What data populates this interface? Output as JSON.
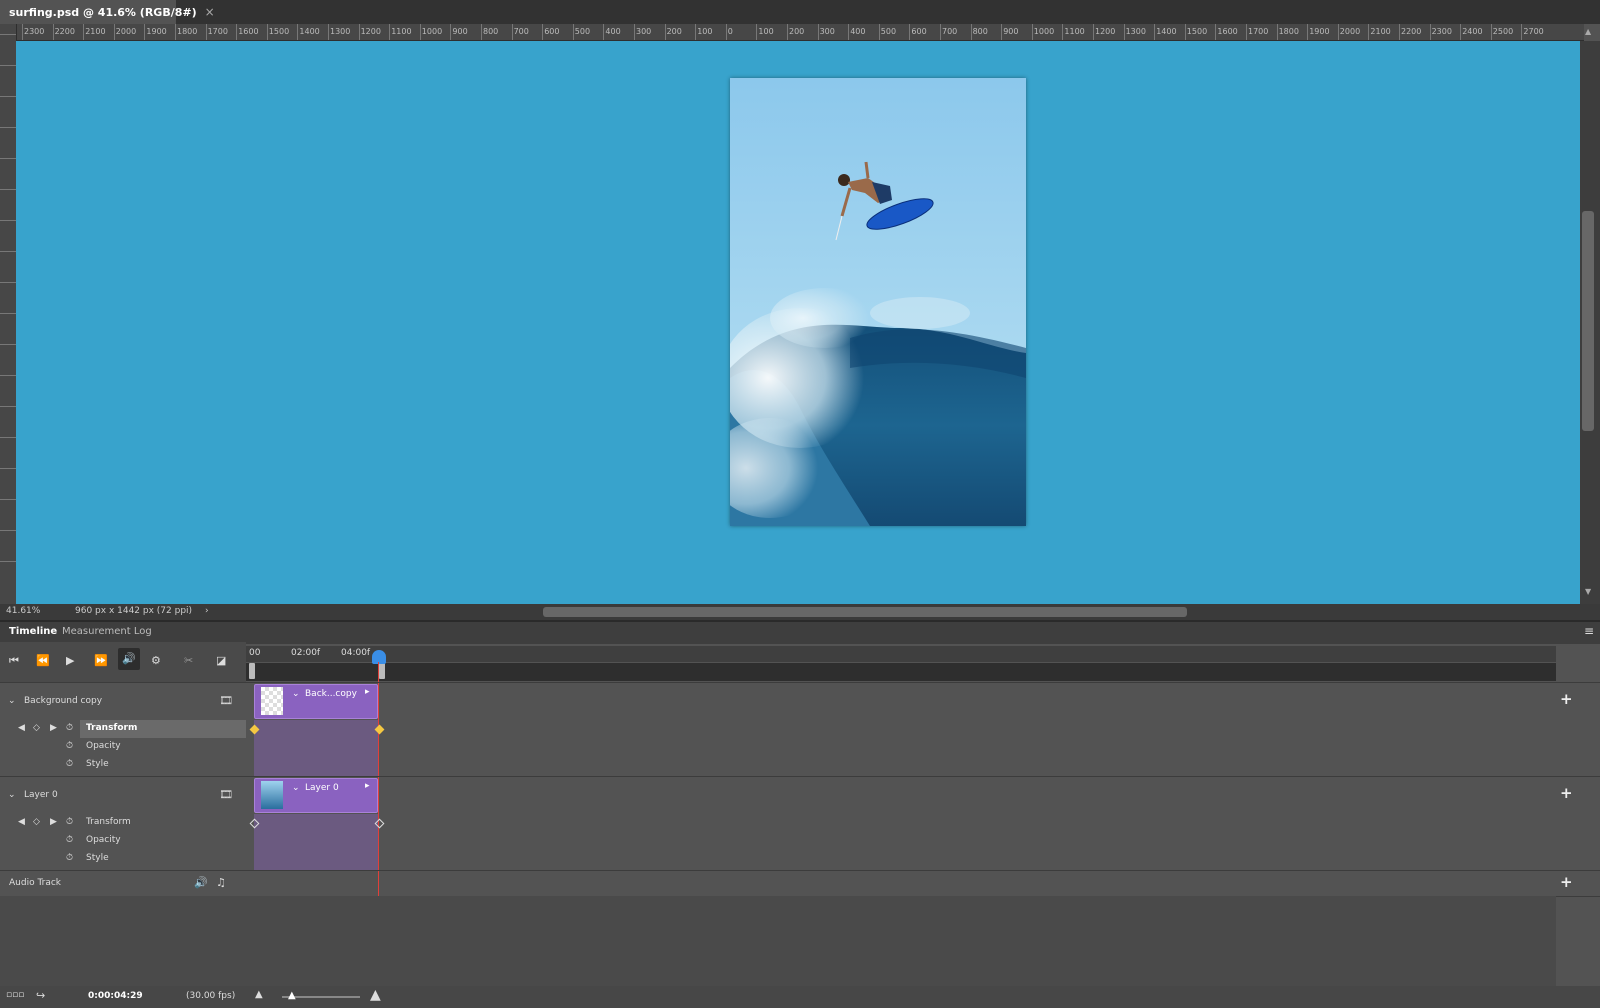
{
  "document": {
    "tab_title": "surfing.psd @ 41.6% (RGB/8#)",
    "close_glyph": "×"
  },
  "ruler": {
    "h_labels": [
      "2300",
      "2200",
      "2100",
      "2000",
      "1900",
      "1800",
      "1700",
      "1600",
      "1500",
      "1400",
      "1300",
      "1200",
      "1100",
      "1000",
      "900",
      "800",
      "700",
      "600",
      "500",
      "400",
      "300",
      "200",
      "100",
      "0",
      "100",
      "200",
      "300",
      "400",
      "500",
      "600",
      "700",
      "800",
      "900",
      "1000",
      "1100",
      "1200",
      "1300",
      "1400",
      "1500",
      "1600",
      "1700",
      "1800",
      "1900",
      "2000",
      "2100",
      "2200",
      "2300",
      "2400",
      "2500",
      "2700"
    ]
  },
  "canvas": {
    "background": "#38a3cc"
  },
  "status": {
    "zoom": "41.61%",
    "doc_info": "960 px x 1442 px (72 ppi)",
    "arrow": "›"
  },
  "panel": {
    "tabs": [
      "Timeline",
      "Measurement Log"
    ],
    "menu_icon": "≡"
  },
  "timeline": {
    "time_labels": [
      "00",
      "02:00f",
      "04:00f"
    ],
    "tracks": [
      {
        "name": "Background copy",
        "clip_label": "Back...copy",
        "props": [
          "Transform",
          "Opacity",
          "Style"
        ],
        "active_prop": "Transform"
      },
      {
        "name": "Layer 0",
        "clip_label": "Layer 0",
        "props": [
          "Transform",
          "Opacity",
          "Style"
        ]
      }
    ],
    "audio_track": "Audio Track",
    "timecode": "0:00:04:29",
    "fps": "(30.00 fps)",
    "keyframe_color": "#f5c842",
    "clip_color": "#8a62c0",
    "playhead_color": "#e0403a"
  }
}
